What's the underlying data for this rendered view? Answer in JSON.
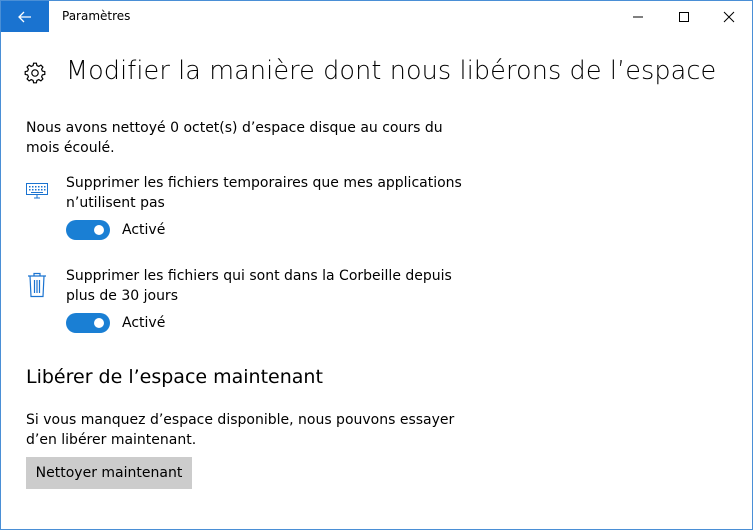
{
  "window": {
    "title": "Paramètres",
    "accent": "#1a73d0"
  },
  "header": {
    "title": "Modifier la manière dont nous libérons de l’espace"
  },
  "intro": "Nous avons nettoyé 0 octet(s) d’espace disque au cours du mois écoulé.",
  "options": [
    {
      "icon": "keyboard-icon",
      "text": "Supprimer les fichiers temporaires que mes applications n’utilisent pas",
      "toggle_on": true,
      "toggle_label": "Activé"
    },
    {
      "icon": "trash-icon",
      "text": "Supprimer les fichiers qui sont dans la Corbeille depuis plus de 30 jours",
      "toggle_on": true,
      "toggle_label": "Activé"
    }
  ],
  "free_now": {
    "title": "Libérer de l’espace maintenant",
    "description": "Si vous manquez d’espace disponible, nous pouvons essayer d’en libérer maintenant.",
    "button_label": "Nettoyer maintenant"
  },
  "colors": {
    "toggle_on": "#1a7fd4",
    "button_bg": "#cccccc"
  }
}
